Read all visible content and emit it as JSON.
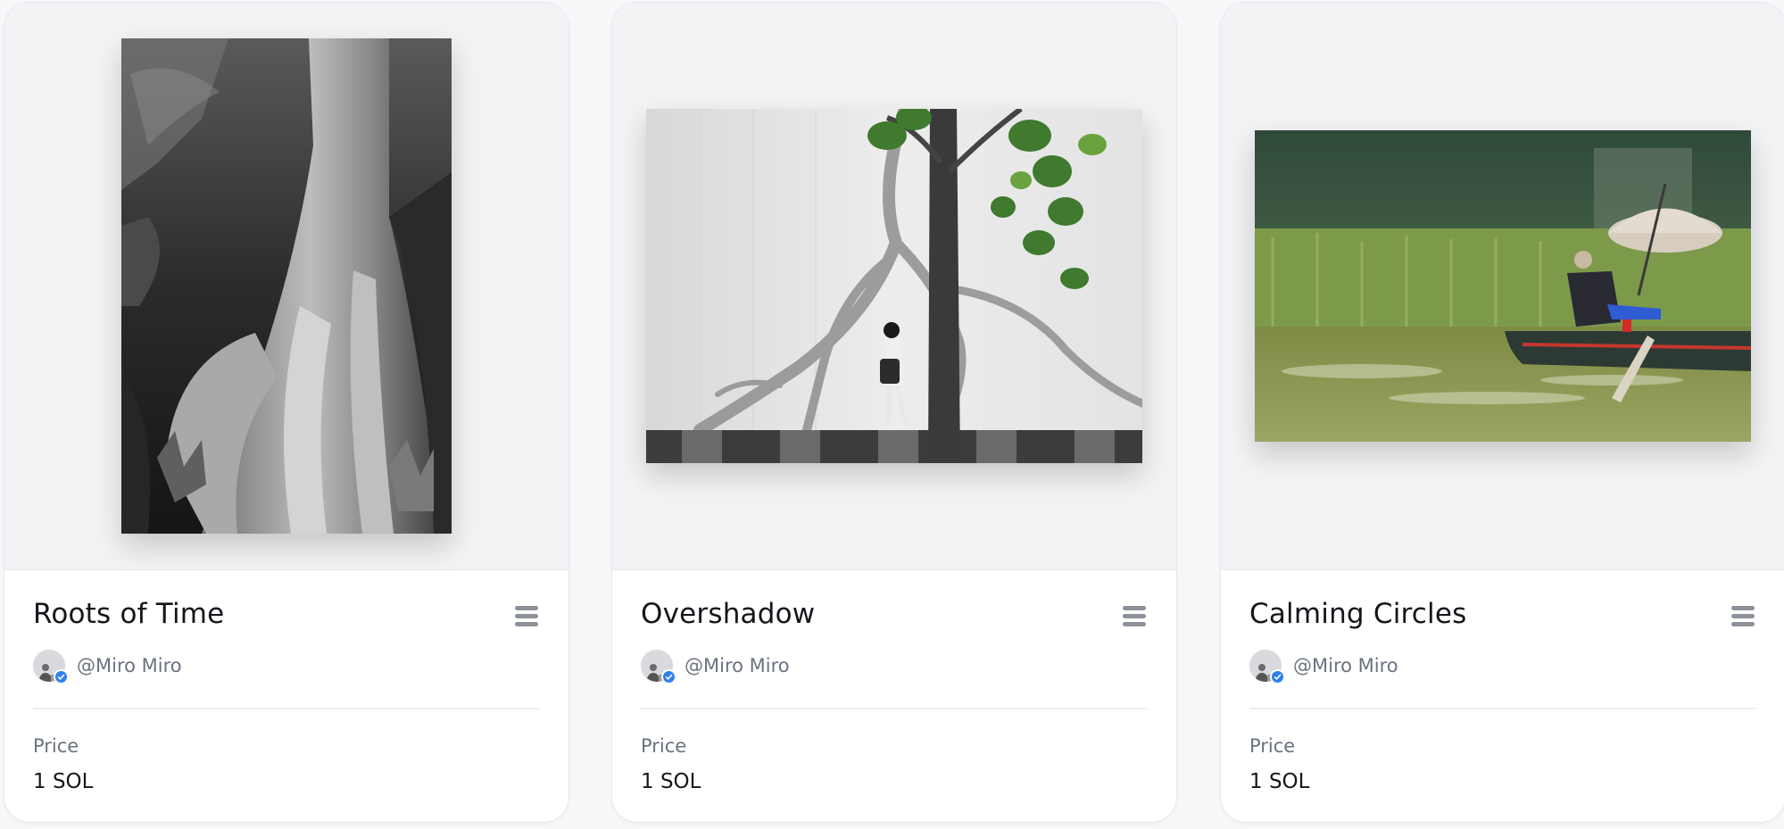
{
  "cards": [
    {
      "title": "Roots of Time",
      "artwork_icon": "tree-roots-photo",
      "creator": "@Miro Miro",
      "price_label": "Price",
      "price": "1 SOL"
    },
    {
      "title": "Overshadow",
      "artwork_icon": "tree-shadow-photo",
      "creator": "@Miro Miro",
      "price_label": "Price",
      "price": "1 SOL"
    },
    {
      "title": "Calming Circles",
      "artwork_icon": "boat-umbrella-photo",
      "creator": "@Miro Miro",
      "price_label": "Price",
      "price": "1 SOL"
    }
  ],
  "colors": {
    "card_bg": "#ffffff",
    "media_bg": "#f2f3f5",
    "title": "#14161b",
    "muted": "#6b7280",
    "verified": "#2f80ed"
  }
}
